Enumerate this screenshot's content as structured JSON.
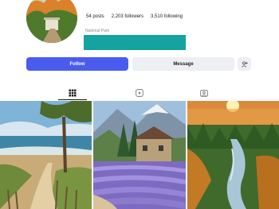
{
  "profile": {
    "posts": "54 posts",
    "followers": "2,203 followers",
    "following": "3,510 following",
    "category": "National Park"
  },
  "actions": {
    "follow_label": "Follow",
    "message_label": "Message",
    "add_icon": "add-person-icon"
  },
  "tabs": [
    {
      "icon": "grid-icon",
      "active": true
    },
    {
      "icon": "reels-icon",
      "active": false
    },
    {
      "icon": "tagged-icon",
      "active": false
    }
  ],
  "colors": {
    "follow": "#4a5cf0",
    "teal_bar": "#14a3a1",
    "secondary_button": "#eeeff2"
  }
}
